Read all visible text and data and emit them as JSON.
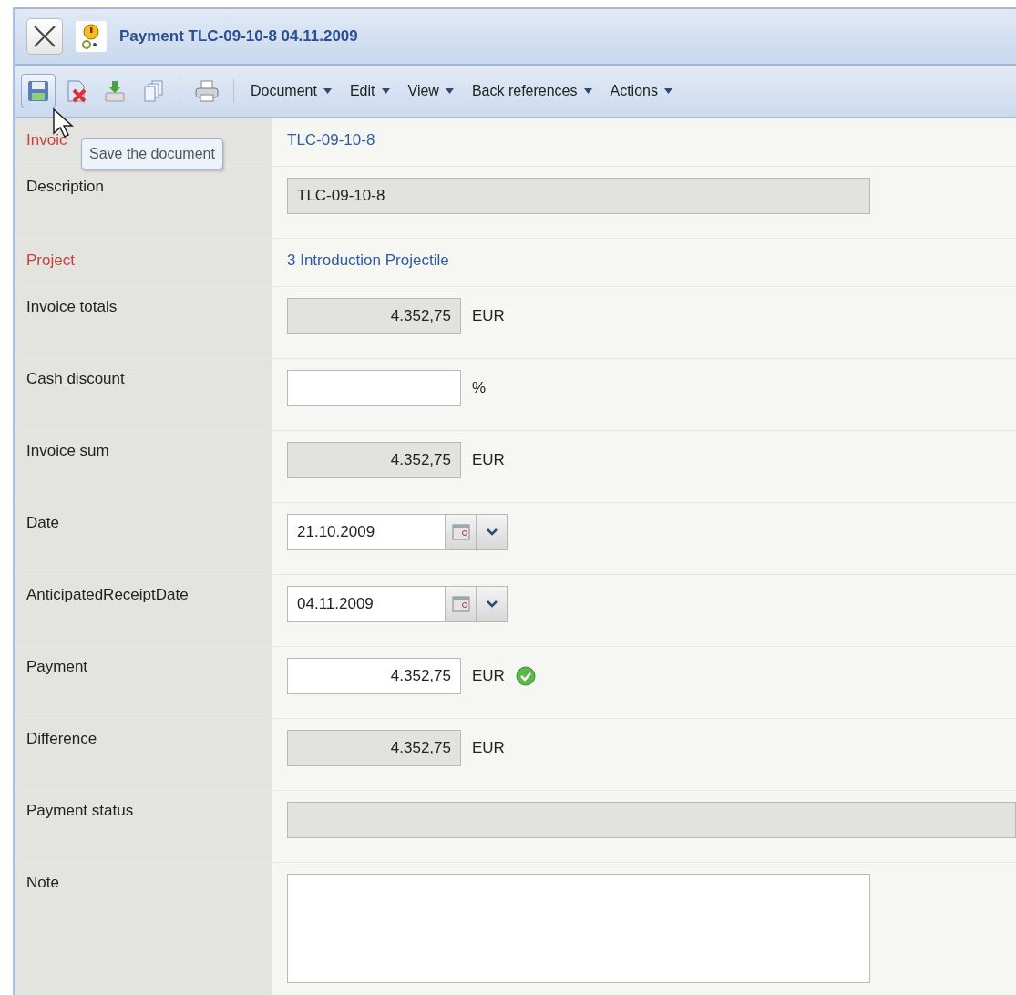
{
  "window": {
    "title": "Payment TLC-09-10-8 04.11.2009"
  },
  "toolbar": {
    "buttons": [
      {
        "kind": "save",
        "hovered": true
      },
      {
        "kind": "delete",
        "hovered": false
      },
      {
        "kind": "export",
        "hovered": false
      },
      {
        "kind": "copy",
        "hovered": false
      },
      {
        "kind": "print",
        "hovered": false
      }
    ],
    "menus": [
      "Document",
      "Edit",
      "View",
      "Back references",
      "Actions"
    ]
  },
  "tooltip": {
    "text": "Save the document"
  },
  "rows": [
    {
      "label": "Invoic",
      "required": true,
      "kind": "link",
      "value": "TLC-09-10-8"
    },
    {
      "label": "Description",
      "required": false,
      "kind": "readonly",
      "value": "TLC-09-10-8"
    },
    {
      "label": "Project",
      "required": true,
      "kind": "link",
      "value": "3 Introduction Projectile"
    },
    {
      "label": "Invoice totals",
      "required": false,
      "kind": "amount",
      "editable": false,
      "value": "4.352,75",
      "unit": "EUR",
      "valid": false
    },
    {
      "label": "Cash discount",
      "required": false,
      "kind": "amount",
      "editable": true,
      "unit": "%",
      "valid": false
    },
    {
      "label": "Invoice sum",
      "required": false,
      "kind": "amount",
      "editable": false,
      "value": "4.352,75",
      "unit": "EUR",
      "valid": false
    },
    {
      "label": "Date",
      "required": false,
      "kind": "date",
      "value": "21.10.2009"
    },
    {
      "label": "AnticipatedReceiptDate",
      "required": false,
      "kind": "date",
      "value": "04.11.2009"
    },
    {
      "label": "Payment",
      "required": false,
      "kind": "amount",
      "editable": true,
      "value": "4.352,75",
      "unit": "EUR",
      "valid": true
    },
    {
      "label": "Difference",
      "required": false,
      "kind": "amount",
      "editable": false,
      "value": "4.352,75",
      "unit": "EUR",
      "valid": false
    },
    {
      "label": "Payment status",
      "required": false,
      "kind": "wide"
    },
    {
      "label": "Note",
      "required": false,
      "kind": "note"
    }
  ]
}
